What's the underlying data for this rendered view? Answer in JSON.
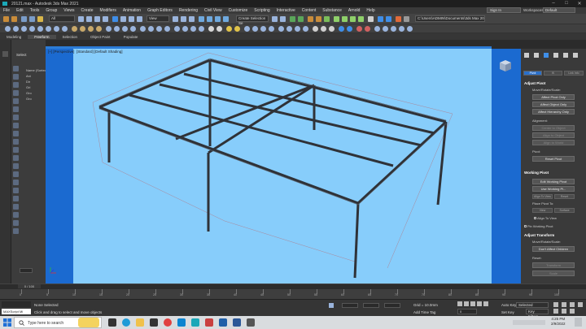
{
  "window": {
    "title": "20121.max - Autodesk 3ds Max 2021",
    "controls": [
      "–",
      "□",
      "✕"
    ]
  },
  "menu": [
    "File",
    "Edit",
    "Tools",
    "Group",
    "Views",
    "Create",
    "Modifiers",
    "Animation",
    "Graph Editors",
    "Rendering",
    "Civil View",
    "Customize",
    "Scripting",
    "Interactive",
    "Content",
    "Substance",
    "Arnold",
    "Help"
  ],
  "account": {
    "sign_in": "Sign In",
    "workspaces_label": "Workspaces:",
    "workspace": "Default"
  },
  "toolbar": {
    "filter": "All",
    "view": "View",
    "selection_set": "Create Selection Se",
    "path": "C:\\Users\\ADMIN\\Documents\\3ds Max 2021"
  },
  "ribbon_tabs": [
    "Modeling",
    "Freeform",
    "Selection",
    "Object Paint",
    "Populate"
  ],
  "ribbon_active": 1,
  "scene_explorer": {
    "header": "Select",
    "items": [
      "Name (Sorted...)",
      "Ani",
      "Dir",
      "Gri",
      "Gro",
      "Gro"
    ]
  },
  "viewport": {
    "label_left": "[+] [Perspective]",
    "label_right": "[Standard] [Default Shading]"
  },
  "command_panel": {
    "tabs": [
      "Pivot",
      "IK",
      "Link Info"
    ],
    "adjust_pivot": {
      "title": "Adjust Pivot",
      "move_rotate_scale": "Move/Rotate/Scale:",
      "buttons": [
        "Affect Pivot Only",
        "Affect Object Only",
        "Affect Hierarchy Only"
      ],
      "alignment_label": "Alignment:",
      "align_buttons": [
        "Center to Object",
        "Align to Object",
        "Align to World"
      ],
      "pivot_label": "Pivot:",
      "reset_pivot": "Reset Pivot"
    },
    "working_pivot": {
      "title": "Working Pivot",
      "edit": "Edit Working Pivot",
      "use": "Use Working Pi...",
      "align_to_view": "Align To View",
      "reset": "Reset",
      "place_label": "Place Pivot To:",
      "view": "View",
      "surface": "Surface",
      "align_to_view_check": "Align To View",
      "pin": "Pin Working Pivot"
    },
    "adjust_transform": {
      "title": "Adjust Transform",
      "move_rotate_scale": "Move/Rotate/Scale:",
      "dont_affect": "Don't Affect Children",
      "reset_label": "Reset:",
      "transform": "Transform",
      "scale": "Scale"
    }
  },
  "timeline": {
    "frame": "0 / 100",
    "ticks": [
      "0",
      "5",
      "10",
      "15",
      "20",
      "25",
      "30",
      "35",
      "40",
      "45",
      "50",
      "55",
      "60",
      "65",
      "70",
      "75",
      "80",
      "85",
      "90",
      "95",
      "100"
    ]
  },
  "status": {
    "selected": "None Selected",
    "prompt": "Click and drag to select and move objects",
    "maxscript": "MAXScript Mi",
    "grid": "Grid = 10.0mm",
    "add_time_tag": "Add Time Tag",
    "auto_key": "Auto Key",
    "set_key": "Set Key",
    "selected_mode": "Selected",
    "key_filters": "Key Filters...",
    "frame_value": "0"
  },
  "taskbar": {
    "search": "Type here to search",
    "time": "4:25 PM",
    "date": "2/9/2022"
  }
}
